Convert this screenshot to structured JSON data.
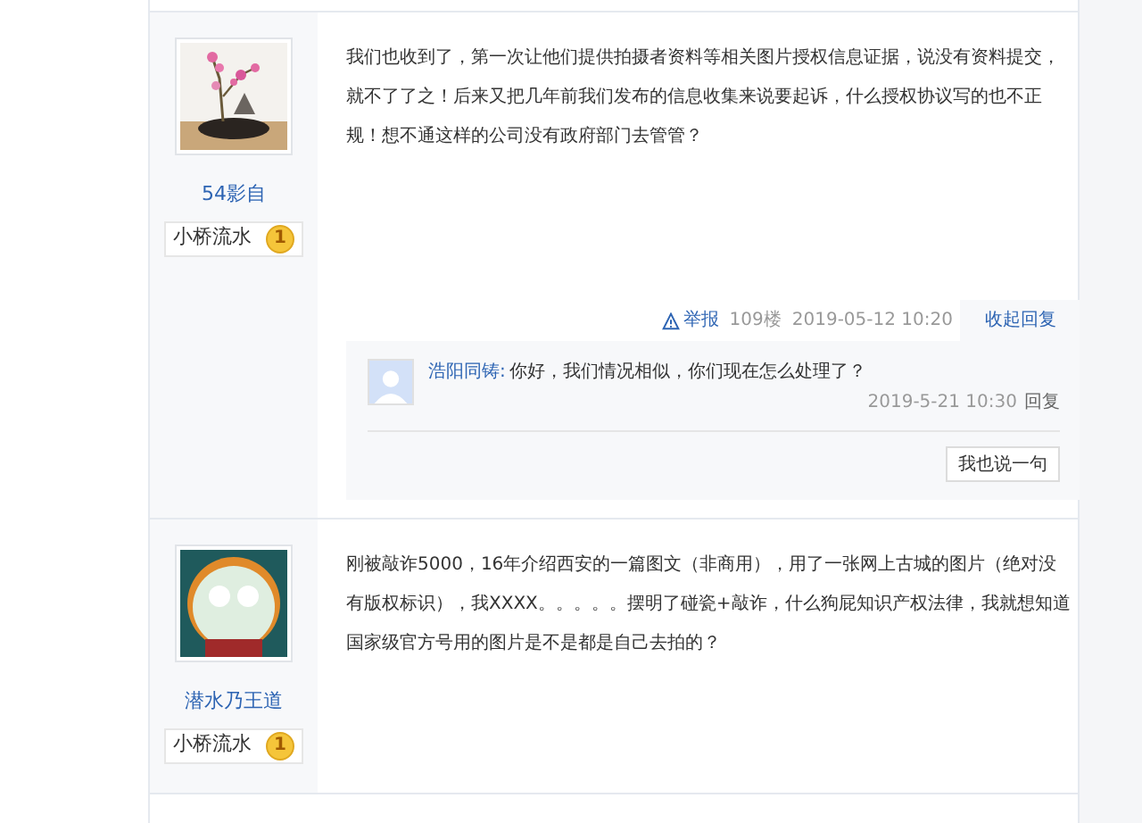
{
  "posts": [
    {
      "author": "54影自",
      "avatar": {
        "kind": "picture"
      },
      "badge": {
        "label": "小桥流水",
        "level": "1"
      },
      "content": "我们也收到了，第一次让他们提供拍摄者资料等相关图片授权信息证据，说没有资料提交，就不了了之！后来又把几年前我们发布的信息收集来说要起诉，什么授权协议写的也不正规！想不通这样的公司没有政府部门去管管？",
      "footer": {
        "report": "举报",
        "floor": "109楼",
        "time": "2019-05-12 10:20",
        "toggle": "收起回复"
      },
      "replies": [
        {
          "user": "浩阳同铸:",
          "text": "你好，我们情况相似，你们现在怎么处理了？",
          "time": "2019-5-21 10:30",
          "action": "回复"
        }
      ],
      "reply_button": "我也说一句"
    },
    {
      "author": "潜水乃王道",
      "avatar": {
        "kind": "picture"
      },
      "badge": {
        "label": "小桥流水",
        "level": "1"
      },
      "content": "刚被敲诈5000，16年介绍西安的一篇图文（非商用），用了一张网上古城的图片（绝对没有版权标识），我XXXX。。。。。摆明了碰瓷+敲诈，什么狗屁知识产权法律，我就想知道国家级官方号用的图片是不是都是自己去拍的？"
    }
  ]
}
